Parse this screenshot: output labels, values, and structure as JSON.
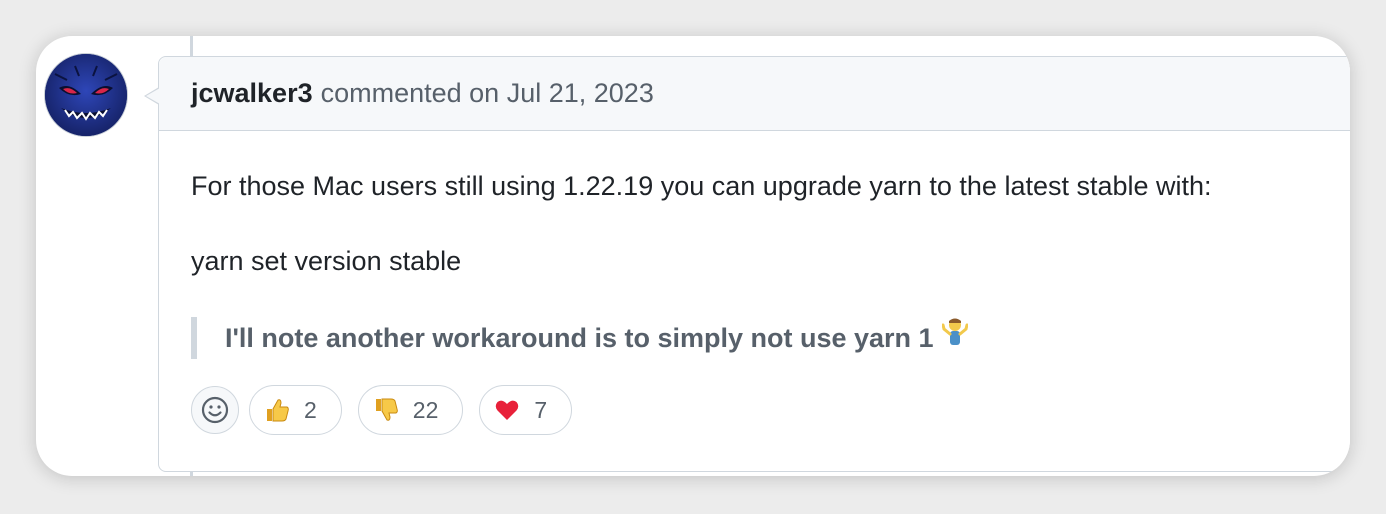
{
  "comment": {
    "author": "jcwalker3",
    "action": "commented on",
    "date": "Jul 21, 2023",
    "body": {
      "paragraph1": "For those Mac users still using 1.22.19 you can upgrade yarn to the latest stable with:",
      "paragraph2": "yarn set version stable",
      "quote": "I'll note another workaround is to simply not use yarn 1"
    },
    "reactions": [
      {
        "emoji": "thumbs-up",
        "count": "2"
      },
      {
        "emoji": "thumbs-down",
        "count": "22"
      },
      {
        "emoji": "heart",
        "count": "7"
      }
    ]
  },
  "colors": {
    "header_bg": "#f6f8fa",
    "border": "#d0d7de",
    "text": "#1f2328",
    "muted": "#57606a",
    "avatar_bg": "#1c2e84"
  }
}
